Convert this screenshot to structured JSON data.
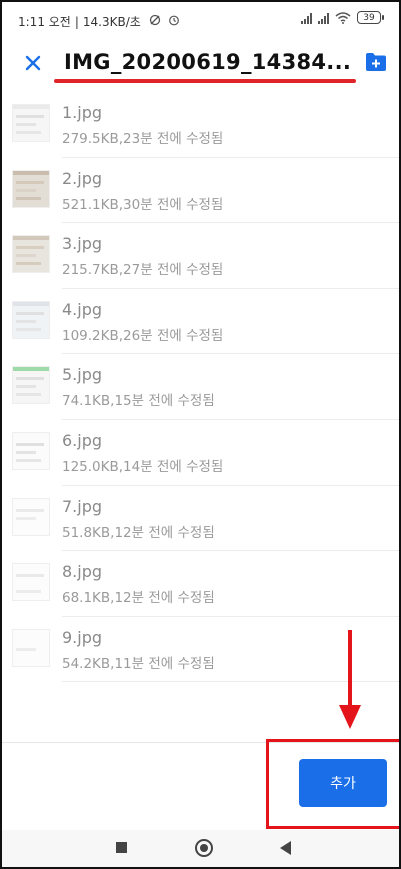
{
  "status_bar": {
    "time": "1:11 오전",
    "network_speed": "14.3KB/초",
    "battery": "39"
  },
  "header": {
    "title": "IMG_20200619_14384..."
  },
  "files": [
    {
      "name": "1.jpg",
      "meta": "279.5KB,23분 전에 수정됨"
    },
    {
      "name": "2.jpg",
      "meta": "521.1KB,30분 전에 수정됨"
    },
    {
      "name": "3.jpg",
      "meta": "215.7KB,27분 전에 수정됨"
    },
    {
      "name": "4.jpg",
      "meta": "109.2KB,26분 전에 수정됨"
    },
    {
      "name": "5.jpg",
      "meta": "74.1KB,15분 전에 수정됨"
    },
    {
      "name": "6.jpg",
      "meta": "125.0KB,14분 전에 수정됨"
    },
    {
      "name": "7.jpg",
      "meta": "51.8KB,12분 전에 수정됨"
    },
    {
      "name": "8.jpg",
      "meta": "68.1KB,12분 전에 수정됨"
    },
    {
      "name": "9.jpg",
      "meta": "54.2KB,11분 전에 수정됨"
    }
  ],
  "actions": {
    "add_label": "추가"
  },
  "colors": {
    "accent": "#1a6fe8",
    "annotation_red": "#e4141b"
  }
}
